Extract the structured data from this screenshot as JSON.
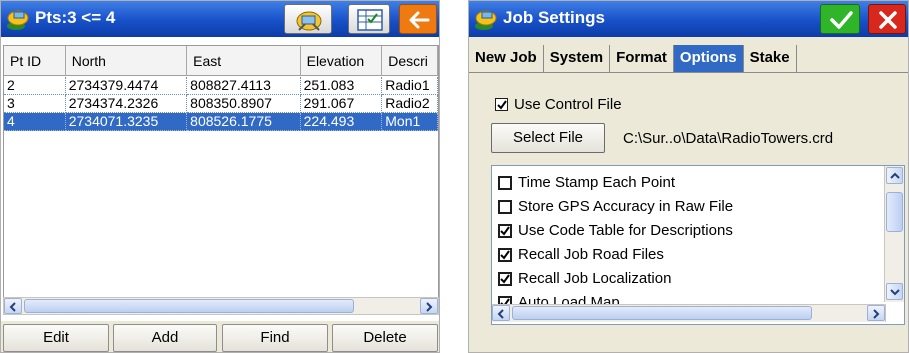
{
  "points_window": {
    "title": "Pts:3 <= 4",
    "icons": [
      "gps-satellite-icon",
      "survey-instrument-icon",
      "table-view-icon",
      "back-arrow-icon"
    ],
    "columns": [
      "Pt ID",
      "North",
      "East",
      "Elevation",
      "Descri"
    ],
    "rows": [
      {
        "id": "2",
        "north": "2734379.4474",
        "east": "808827.4113",
        "elevation": "251.083",
        "desc": "Radio1"
      },
      {
        "id": "3",
        "north": "2734374.2326",
        "east": "808350.8907",
        "elevation": "291.067",
        "desc": "Radio2"
      },
      {
        "id": "4",
        "north": "2734071.3235",
        "east": "808526.1775",
        "elevation": "224.493",
        "desc": "Mon1"
      }
    ],
    "selected_row": 2,
    "buttons": {
      "edit": "Edit",
      "add": "Add",
      "find": "Find",
      "delete": "Delete"
    }
  },
  "job_settings": {
    "title": "Job Settings",
    "tabs": [
      "New Job",
      "System",
      "Format",
      "Options",
      "Stake"
    ],
    "active_tab": "Options",
    "use_control_file": {
      "label": "Use Control File",
      "checked": true
    },
    "select_file_label": "Select File",
    "file_path": "C:\\Sur..o\\Data\\RadioTowers.crd",
    "options": [
      {
        "label": "Time Stamp Each Point",
        "checked": false
      },
      {
        "label": "Store GPS Accuracy in Raw File",
        "checked": false
      },
      {
        "label": "Use Code Table for Descriptions",
        "checked": true
      },
      {
        "label": "Recall Job Road Files",
        "checked": true
      },
      {
        "label": "Recall Job Localization",
        "checked": true
      },
      {
        "label": "Auto Load Map",
        "checked": true
      }
    ]
  },
  "colors": {
    "titlebar": "#1850c8",
    "selection": "#316ac5",
    "ok_green": "#2fb42a",
    "close_red": "#d8281e",
    "back_orange": "#f07a12"
  }
}
